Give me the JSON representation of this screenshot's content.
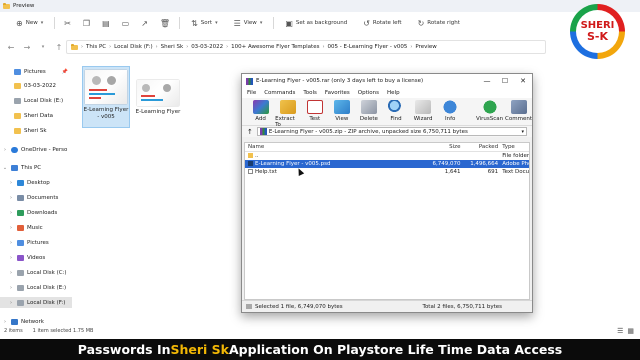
{
  "explorer": {
    "title": "Preview",
    "toolbar": {
      "new_label": "New",
      "sort_label": "Sort",
      "view_label": "View",
      "set_background_label": "Set as background",
      "rotate_left_label": "Rotate left",
      "rotate_right_label": "Rotate right"
    },
    "breadcrumb": [
      "This PC",
      "Local Disk (F:)",
      "Sheri Sk",
      "03-03-2022",
      "100+ Awesome Flyer Templates",
      "005 - E-Learning Flyer - v005",
      "Preview"
    ],
    "sidebar": {
      "items": [
        {
          "label": "Pictures",
          "icon": "pictures-icon",
          "pinned": true
        },
        {
          "label": "03-03-2022",
          "icon": "folder-icon"
        },
        {
          "label": "Local Disk (E:)",
          "icon": "disk-icon"
        },
        {
          "label": "Sheri Data",
          "icon": "folder-icon"
        },
        {
          "label": "Sheri Sk",
          "icon": "folder-icon"
        },
        {
          "label": "OneDrive - Perso",
          "icon": "onedrive-icon"
        },
        {
          "label": "This PC",
          "icon": "pc-icon"
        },
        {
          "label": "Desktop",
          "icon": "desktop-icon"
        },
        {
          "label": "Documents",
          "icon": "documents-icon"
        },
        {
          "label": "Downloads",
          "icon": "downloads-icon"
        },
        {
          "label": "Music",
          "icon": "music-icon"
        },
        {
          "label": "Pictures",
          "icon": "pictures-icon"
        },
        {
          "label": "Videos",
          "icon": "videos-icon"
        },
        {
          "label": "Local Disk (C:)",
          "icon": "disk-icon"
        },
        {
          "label": "Local Disk (E:)",
          "icon": "disk-icon"
        },
        {
          "label": "Local Disk (F:)",
          "icon": "disk-icon",
          "selected": true
        },
        {
          "label": "Network",
          "icon": "network-icon"
        }
      ]
    },
    "files": [
      {
        "label": "E-Learning Flyer - v005",
        "selected": true
      },
      {
        "label": "E-Learning Flyer"
      }
    ],
    "status": {
      "items_count": "2 items",
      "selection": "1 item selected  1.75 MB"
    }
  },
  "logo": {
    "line1": "SHERI",
    "line2": "S-K"
  },
  "winrar": {
    "title": "E-Learning Flyer - v005.rar (only 3 days left to buy a license)",
    "menu": [
      "File",
      "Commands",
      "Tools",
      "Favorites",
      "Options",
      "Help"
    ],
    "toolbar": [
      "Add",
      "Extract To",
      "Test",
      "View",
      "Delete",
      "Find",
      "Wizard",
      "Info",
      "VirusScan",
      "Comment"
    ],
    "path": "E-Learning Flyer - v005.zip - ZIP archive, unpacked size 6,750,711 bytes",
    "columns": {
      "name": "Name",
      "size": "Size",
      "packed": "Packed",
      "type": "Type"
    },
    "rows": [
      {
        "name": "..",
        "size": "",
        "packed": "",
        "type": "File folder",
        "icon": "folder-up-icon"
      },
      {
        "name": "E-Learning Flyer - v005.psd",
        "size": "6,749,070",
        "packed": "1,496,664",
        "type": "Adobe Phot",
        "icon": "psd-file-icon",
        "selected": true
      },
      {
        "name": "Help.txt",
        "size": "1,641",
        "packed": "691",
        "type": "Text Docum",
        "icon": "text-file-icon"
      }
    ],
    "status_left": "Selected 1 file, 6,749,070 bytes",
    "status_right": "Total 2 files, 6,750,711 bytes"
  },
  "banner": {
    "part1": "Passwords In ",
    "highlight": "Sheri Sk",
    "part2": " Application On Playstore  Life Time Data Access"
  }
}
